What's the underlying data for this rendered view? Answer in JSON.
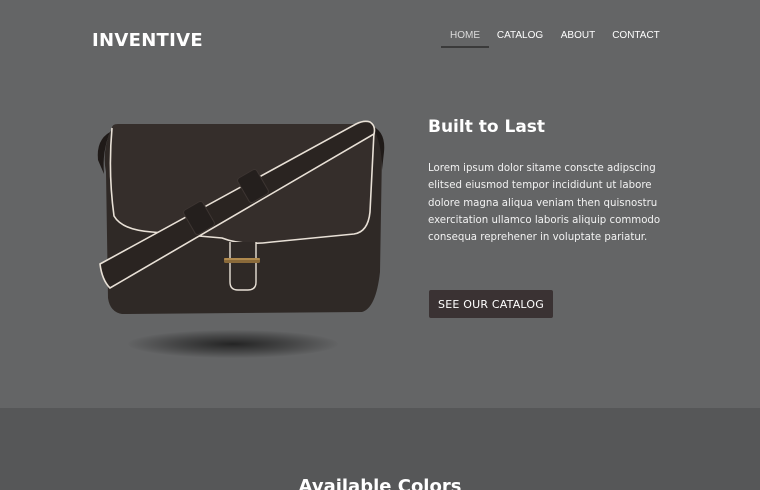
{
  "brand": {
    "logo_text": "INVENTIVE"
  },
  "nav": {
    "items": [
      {
        "label": "HOME",
        "active": true
      },
      {
        "label": "CATALOG",
        "active": false
      },
      {
        "label": "ABOUT",
        "active": false
      },
      {
        "label": "CONTACT",
        "active": false
      }
    ]
  },
  "hero": {
    "title": "Built to Last",
    "body": "Lorem ipsum dolor sitame conscte adipscing elitsed eiusmod tempor incididunt ut labore dolore magna aliqua  veniam then quisnostru exercitation ullamco laboris aliquip commodo consequa reprehener in voluptate pariatur.",
    "cta_label": "SEE OUR CATALOG",
    "image": "messenger-bag"
  },
  "colors_section": {
    "title": "Available Colors"
  },
  "colors": {
    "page_bg": "#646566",
    "section_bg": "#565758",
    "button_bg": "#3a3233",
    "bag": "#2f2926",
    "bag_piping": "#e8e0d6"
  }
}
